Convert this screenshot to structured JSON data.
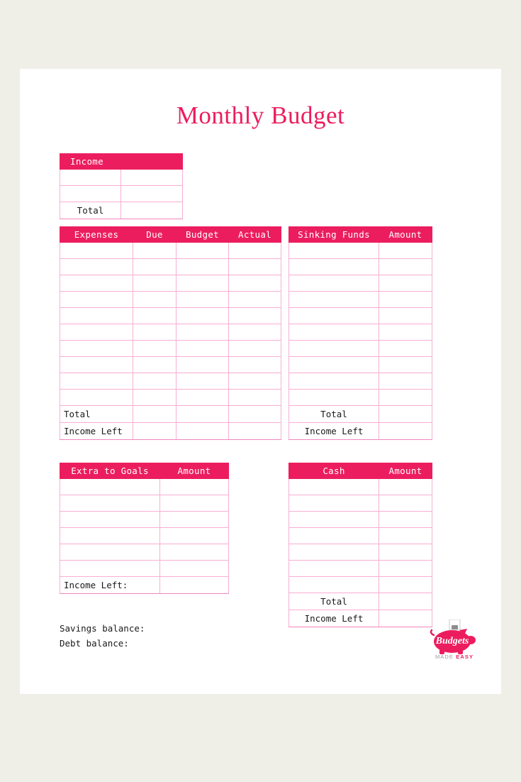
{
  "page": {
    "title": "Monthly Budget",
    "background_color": "#efefe8",
    "card_color": "#ffffff",
    "accent_color": "#ec1d5e",
    "grid_color": "#f9aed2"
  },
  "income_table": {
    "header": "Income",
    "blank_rows": 2,
    "total_label": "Total"
  },
  "expenses_table": {
    "headers": [
      "Expenses",
      "Due",
      "Budget",
      "Actual"
    ],
    "blank_rows": 10,
    "total_label": "Total",
    "income_left_label": "Income Left"
  },
  "sinking_funds_table": {
    "headers": [
      "Sinking Funds",
      "Amount"
    ],
    "blank_rows": 10,
    "total_label": "Total",
    "income_left_label": "Income Left"
  },
  "extra_to_goals_table": {
    "headers": [
      "Extra to Goals",
      "Amount"
    ],
    "blank_rows": 6,
    "income_left_label": "Income Left:"
  },
  "cash_table": {
    "headers": [
      "Cash",
      "Amount"
    ],
    "blank_rows": 7,
    "total_label": "Total",
    "income_left_label": "Income Left"
  },
  "balances": {
    "savings_label": "Savings balance:",
    "debt_label": "Debt balance:"
  },
  "logo": {
    "script_text": "Budgets",
    "tagline_made": "MADE",
    "tagline_easy": "EASY"
  }
}
